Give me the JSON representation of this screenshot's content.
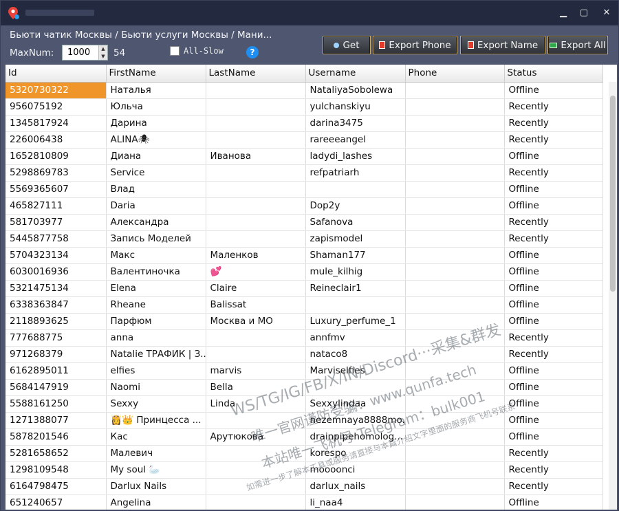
{
  "window": {
    "minimize": "▁",
    "maximize": "▢",
    "close": "✕"
  },
  "toolbar": {
    "breadcrumb": "Бьюти чатик Москвы / Бьюти услуги Москвы / Мани...",
    "maxnum_label": "MaxNum:",
    "maxnum_value": "1000",
    "count": "54",
    "all_slow_label": "All-Slow",
    "help": "?",
    "buttons": {
      "get": "Get",
      "export_phone": "Export Phone",
      "export_name": "Export Name",
      "export_all": "Export All"
    }
  },
  "table": {
    "headers": [
      "Id",
      "FirstName",
      "LastName",
      "Username",
      "Phone",
      "Status"
    ],
    "rows": [
      [
        "5320730322",
        "Наталья",
        "",
        "NataliyaSobolewa",
        "",
        "Offline"
      ],
      [
        "956075192",
        "Юльча",
        "",
        "yulchanskiyu",
        "",
        "Recently"
      ],
      [
        "1345817924",
        "Дарина",
        "",
        "darina3475",
        "",
        "Recently"
      ],
      [
        "226006438",
        "ALINA🕷",
        "",
        "rareeeangel",
        "",
        "Recently"
      ],
      [
        "1652810809",
        "Диана",
        "Иванова",
        "ladydi_lashes",
        "",
        "Offline"
      ],
      [
        "5298869783",
        "Service",
        "",
        "refpatriarh",
        "",
        "Recently"
      ],
      [
        "5569365607",
        "Влад",
        "",
        "",
        "",
        "Offline"
      ],
      [
        "465827111",
        "Daria",
        "",
        "Dop2y",
        "",
        "Offline"
      ],
      [
        "581703977",
        "Александра",
        "",
        "Safanova",
        "",
        "Recently"
      ],
      [
        "5445877758",
        "Запись Моделей",
        "",
        "zapismodel",
        "",
        "Recently"
      ],
      [
        "5704323134",
        "Макс",
        "Маленков",
        "Shaman177",
        "",
        "Offline"
      ],
      [
        "6030016936",
        "Валентиночка",
        "💕",
        "mule_kilhig",
        "",
        "Offline"
      ],
      [
        "5321475134",
        "Elena",
        "Claire",
        "Reineclair1",
        "",
        "Offline"
      ],
      [
        "6338363847",
        "Rheane",
        "Balissat",
        "",
        "",
        "Offline"
      ],
      [
        "2118893625",
        "Парфюм",
        "Москва и МО",
        "Luxury_perfume_1",
        "",
        "Offline"
      ],
      [
        "777688775",
        "anna",
        "",
        "annfmv",
        "",
        "Recently"
      ],
      [
        "971268379",
        "Natalie ТРАФИК | З...",
        "",
        "nataco8",
        "",
        "Recently"
      ],
      [
        "6162895011",
        "elfies",
        "marvis",
        "Marviselfies",
        "",
        "Offline"
      ],
      [
        "5684147919",
        "Naomi",
        "Bella",
        "",
        "",
        "Offline"
      ],
      [
        "5588161250",
        "Sexxy",
        "Linda",
        "Sexxylindaa",
        "",
        "Offline"
      ],
      [
        "1271388077",
        "👸👑 Принцесса ...",
        "",
        "nezemnaya8888mo...",
        "",
        "Offline"
      ],
      [
        "5878201546",
        "Кас",
        "Арутюкова",
        "drainpipehomolog...",
        "",
        "Offline"
      ],
      [
        "5281658652",
        "Малевич",
        "",
        "korespo",
        "",
        "Recently"
      ],
      [
        "1298109548",
        "My soul 🦢",
        "",
        "mooooncі",
        "",
        "Recently"
      ],
      [
        "6164798475",
        "Darlux Nails",
        "",
        "darlux_nails",
        "",
        "Recently"
      ],
      [
        "651240657",
        "Angelina",
        "",
        "li_naa4",
        "",
        "Offline"
      ]
    ]
  },
  "watermark": {
    "line1": "WS/TG/IG/FB/X/IN/Discord···采集&群发",
    "line2": "唯一官网谨防受骗：www.qunfa.tech",
    "line3": "本站唯一飞机号 Telegram：bulk001",
    "line4": "如需进一步了解本工具或服务请直接与本篇介绍文字里面的服务商飞机号联系"
  }
}
